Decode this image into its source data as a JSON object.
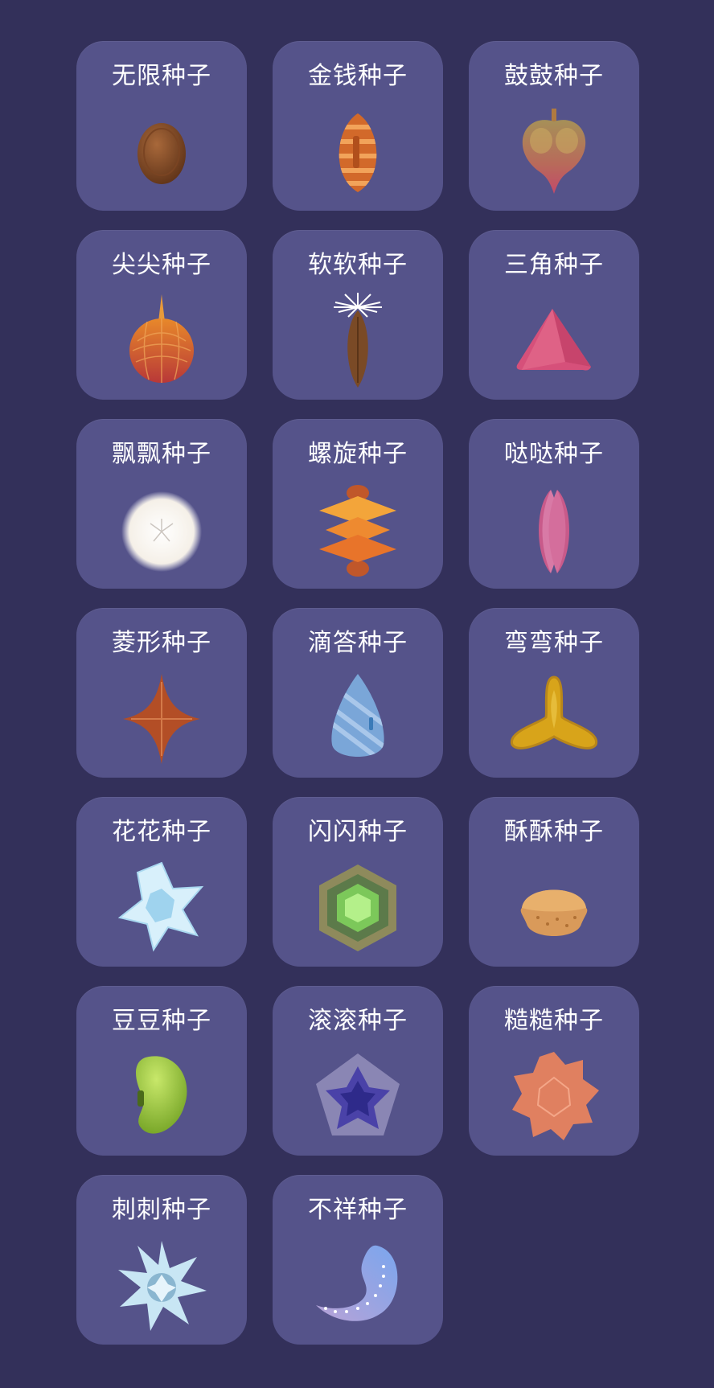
{
  "seeds": [
    {
      "label": "无限种子",
      "icon": "brown-oval-seed-icon"
    },
    {
      "label": "金钱种子",
      "icon": "orange-striped-seed-icon"
    },
    {
      "label": "鼓鼓种子",
      "icon": "bulb-heart-seed-icon"
    },
    {
      "label": "尖尖种子",
      "icon": "spiked-round-seed-icon"
    },
    {
      "label": "软软种子",
      "icon": "dandelion-tuft-seed-icon"
    },
    {
      "label": "三角种子",
      "icon": "pink-triangle-seed-icon"
    },
    {
      "label": "飘飘种子",
      "icon": "white-fluff-ball-icon"
    },
    {
      "label": "螺旋种子",
      "icon": "orange-spiral-stack-icon"
    },
    {
      "label": "哒哒种子",
      "icon": "pink-pod-seed-icon"
    },
    {
      "label": "菱形种子",
      "icon": "brown-diamond-star-icon"
    },
    {
      "label": "滴答种子",
      "icon": "blue-droplet-seed-icon"
    },
    {
      "label": "弯弯种子",
      "icon": "yellow-curved-tri-seed-icon"
    },
    {
      "label": "花花种子",
      "icon": "ice-flower-seed-icon"
    },
    {
      "label": "闪闪种子",
      "icon": "green-hexagon-seed-icon"
    },
    {
      "label": "酥酥种子",
      "icon": "tan-cracker-seed-icon"
    },
    {
      "label": "豆豆种子",
      "icon": "green-bean-seed-icon"
    },
    {
      "label": "滚滚种子",
      "icon": "purple-star-pentagon-icon"
    },
    {
      "label": "糙糙种子",
      "icon": "orange-rough-star-icon"
    },
    {
      "label": "刺刺种子",
      "icon": "ice-star-spiky-icon"
    },
    {
      "label": "不祥种子",
      "icon": "blue-comet-seed-icon"
    }
  ],
  "colors": {
    "background": "#33305a",
    "card": "#55538a",
    "label": "#ffffff"
  }
}
